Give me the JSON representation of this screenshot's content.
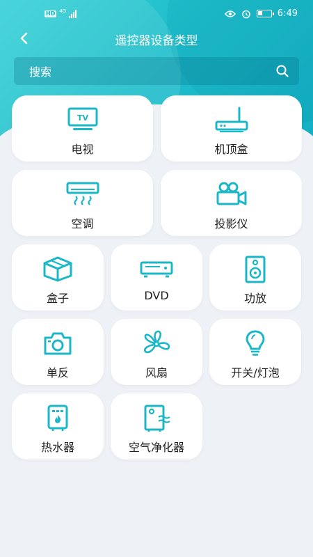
{
  "status_bar": {
    "network_badge": "HD",
    "net_type": "4G",
    "time": "6:49"
  },
  "header": {
    "title": "遥控器设备类型"
  },
  "search": {
    "label": "搜索"
  },
  "devices": [
    {
      "label": "电视",
      "icon": "tv-icon"
    },
    {
      "label": "机顶盒",
      "icon": "set-top-box-icon"
    },
    {
      "label": "空调",
      "icon": "air-conditioner-icon"
    },
    {
      "label": "投影仪",
      "icon": "projector-icon"
    },
    {
      "label": "盒子",
      "icon": "box-icon"
    },
    {
      "label": "DVD",
      "icon": "dvd-player-icon"
    },
    {
      "label": "功放",
      "icon": "speaker-icon"
    },
    {
      "label": "单反",
      "icon": "camera-icon"
    },
    {
      "label": "风扇",
      "icon": "fan-icon"
    },
    {
      "label": "开关/灯泡",
      "icon": "light-bulb-icon"
    },
    {
      "label": "热水器",
      "icon": "water-heater-icon"
    },
    {
      "label": "空气净化器",
      "icon": "air-purifier-icon"
    }
  ],
  "colors": {
    "accent": "#1bb7c7",
    "hero_start": "#35d0d6",
    "hero_end": "#12aec3",
    "background": "#eef2f6"
  }
}
